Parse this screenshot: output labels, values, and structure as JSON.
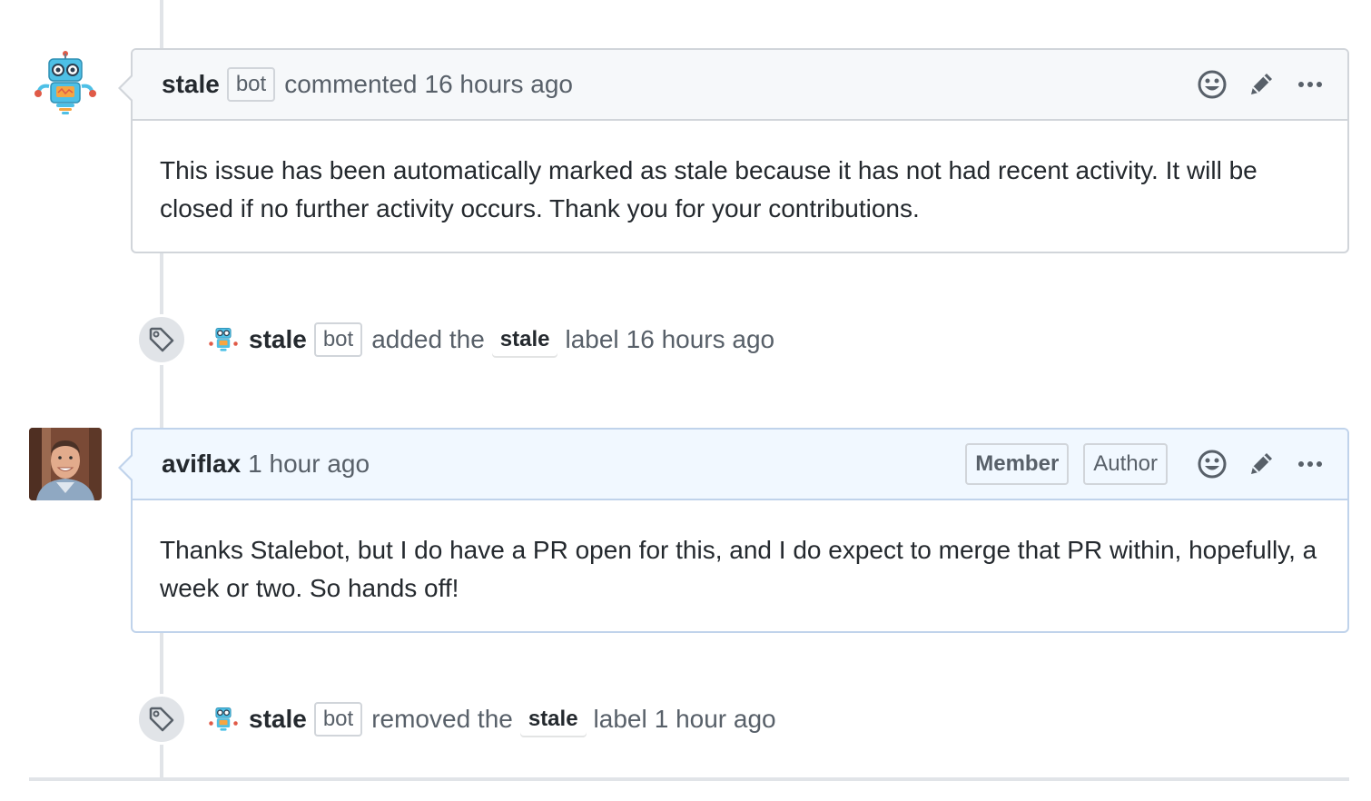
{
  "comments": [
    {
      "author": "stale",
      "badge": "bot",
      "action": "commented",
      "time": "16 hours ago",
      "body": "This issue has been automatically marked as stale because it has not had recent activity. It will be closed if no further activity occurs. Thank you for your contributions."
    },
    {
      "author": "aviflax",
      "time": "1 hour ago",
      "roles": [
        "Member",
        "Author"
      ],
      "body": "Thanks Stalebot, but I do have a PR open for this, and I do expect to merge that PR within, hopefully, a week or two. So hands off!"
    }
  ],
  "events": [
    {
      "icon": "tag-icon",
      "actor": "stale",
      "badge": "bot",
      "verb": "added the",
      "label": "stale",
      "suffix": "label",
      "time": "16 hours ago"
    },
    {
      "icon": "tag-icon",
      "actor": "stale",
      "badge": "bot",
      "verb": "removed the",
      "label": "stale",
      "suffix": "label",
      "time": "1 hour ago"
    }
  ],
  "colors": {
    "own_comment_header": "#f1f8ff",
    "comment_header": "#f6f8fa",
    "timeline": "#e1e4e8"
  }
}
